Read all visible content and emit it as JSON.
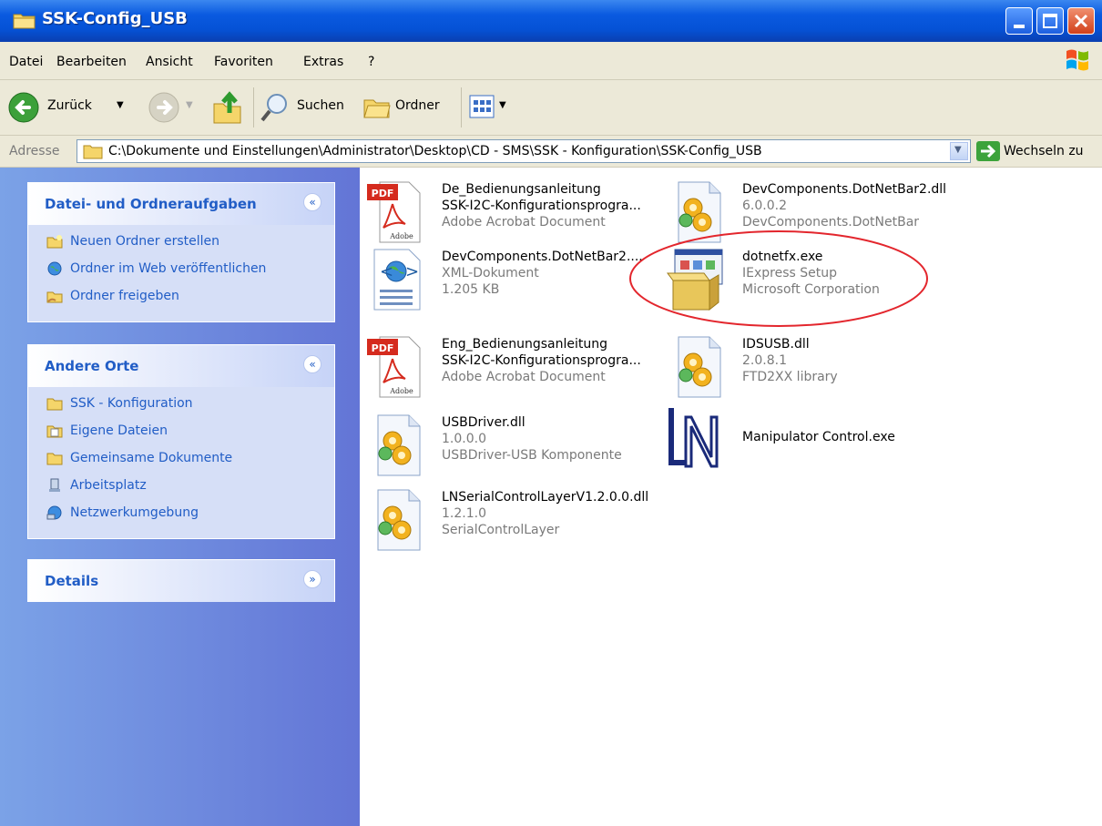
{
  "window": {
    "title": "SSK-Config_USB"
  },
  "menu": [
    "Datei",
    "Bearbeiten",
    "Ansicht",
    "Favoriten",
    "Extras",
    "?"
  ],
  "toolbar": {
    "back": "Zurück",
    "search": "Suchen",
    "folders": "Ordner"
  },
  "address": {
    "label": "Adresse",
    "path": "C:\\Dokumente und Einstellungen\\Administrator\\Desktop\\CD - SMS\\SSK - Konfiguration\\SSK-Config_USB",
    "go": "Wechseln zu"
  },
  "tasks": {
    "title": "Datei- und Ordneraufgaben",
    "items": [
      "Neuen Ordner erstellen",
      "Ordner im Web veröffentlichen",
      "Ordner freigeben"
    ]
  },
  "places": {
    "title": "Andere Orte",
    "items": [
      "SSK - Konfiguration",
      "Eigene Dateien",
      "Gemeinsame Dokumente",
      "Arbeitsplatz",
      "Netzwerkumgebung"
    ]
  },
  "details": {
    "title": "Details"
  },
  "files": [
    {
      "name": "De_Bedienungsanleitung",
      "line2": "SSK-I2C-Konfigurationsprogra...",
      "line3": "Adobe Acrobat Document",
      "icon": "pdf-icon"
    },
    {
      "name": "DevComponents.DotNetBar2.dll",
      "line2": "6.0.0.2",
      "line3": "DevComponents.DotNetBar",
      "icon": "dll-icon"
    },
    {
      "name": "DevComponents.DotNetBar2....",
      "line2": "XML-Dokument",
      "line3": "1.205 KB",
      "icon": "xml-icon"
    },
    {
      "name": "dotnetfx.exe",
      "line2": "IExpress Setup",
      "line3": "Microsoft Corporation",
      "icon": "setup-icon"
    },
    {
      "name": "Eng_Bedienungsanleitung",
      "line2": "SSK-I2C-Konfigurationsprogra...",
      "line3": "Adobe Acrobat Document",
      "icon": "pdf-icon"
    },
    {
      "name": "IDSUSB.dll",
      "line2": "2.0.8.1",
      "line3": "FTD2XX library",
      "icon": "dll-icon"
    },
    {
      "name": "USBDriver.dll",
      "line2": "1.0.0.0",
      "line3": "USBDriver-USB Komponente",
      "icon": "dll-icon"
    },
    {
      "name": "Manipulator Control.exe",
      "icon": "ln-app-icon"
    },
    {
      "name": "LNSerialControlLayerV1.2.0.0.dll",
      "line2": "1.2.1.0",
      "line3": "SerialControlLayer",
      "icon": "dll-icon"
    }
  ]
}
